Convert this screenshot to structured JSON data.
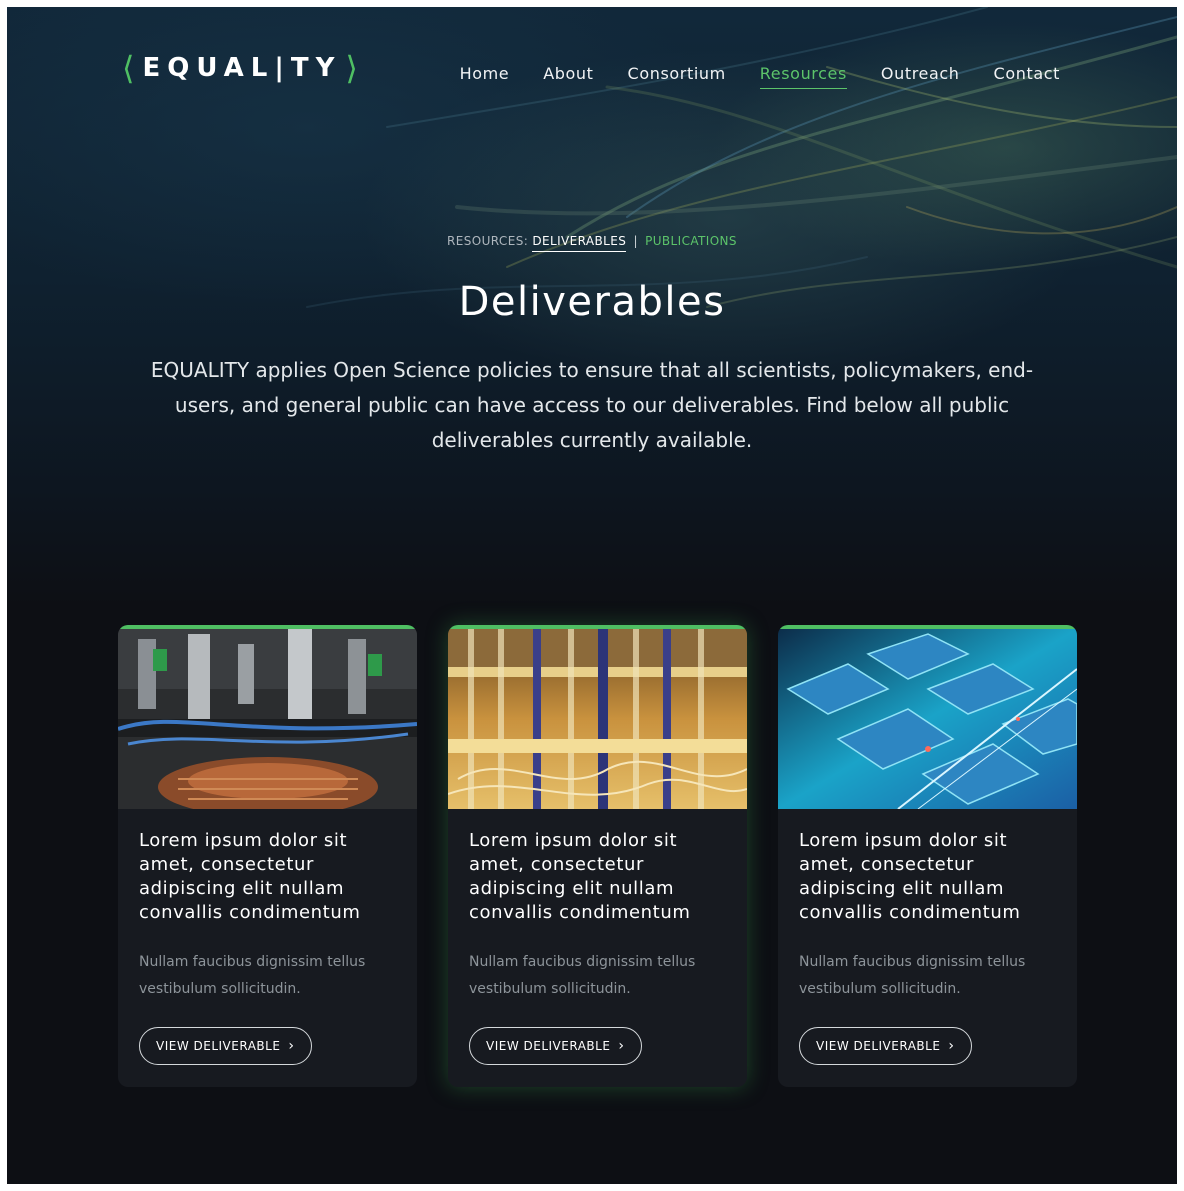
{
  "brand": {
    "logo_text": "EQUAL|TY",
    "open_bracket": "⟨",
    "close_bracket": "⟩",
    "accent": "#4fbf63"
  },
  "nav": {
    "items": [
      {
        "label": "Home"
      },
      {
        "label": "About"
      },
      {
        "label": "Consortium"
      },
      {
        "label": "Resources",
        "active": true
      },
      {
        "label": "Outreach"
      },
      {
        "label": "Contact"
      }
    ]
  },
  "breadcrumb": {
    "prefix": "RESOURCES:",
    "current": "DELIVERABLES",
    "separator": "|",
    "other": "PUBLICATIONS"
  },
  "page": {
    "title": "Deliverables",
    "lead": "EQUALITY applies Open Science policies to ensure that all scientists, policymakers, end-users, and general public can have access to our deliverables. Find below all public deliverables currently available."
  },
  "cards": [
    {
      "title": "Lorem ipsum dolor sit amet, consectetur adipiscing elit nullam convallis condimentum",
      "text": "Nullam faucibus dignissim tellus vestibulum sollicitudin.",
      "button": "VIEW DELIVERABLE",
      "image": "lab-equipment-image"
    },
    {
      "title": "Lorem ipsum dolor sit amet, consectetur adipiscing elit nullam convallis condimentum",
      "text": "Nullam faucibus dignissim tellus vestibulum sollicitudin.",
      "button": "VIEW DELIVERABLE",
      "image": "quantum-computer-image"
    },
    {
      "title": "Lorem ipsum dolor sit amet, consectetur adipiscing elit nullam convallis condimentum",
      "text": "Nullam faucibus dignissim tellus vestibulum sollicitudin.",
      "button": "VIEW DELIVERABLE",
      "image": "microchip-image"
    }
  ],
  "icons": {
    "button_chevron": "chevron-right-icon"
  }
}
